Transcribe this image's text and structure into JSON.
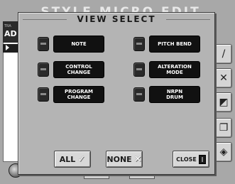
{
  "background": {
    "title": "STYLE MICRO EDIT",
    "header_small": "TRA",
    "header_main": "AD"
  },
  "dialog": {
    "title": "VIEW SELECT",
    "options_left": [
      {
        "label": "NOTE"
      },
      {
        "label": "CONTROL\nCHANGE"
      },
      {
        "label": "PROGRAM\nCHANGE"
      }
    ],
    "options_right": [
      {
        "label": "PITCH BEND"
      },
      {
        "label": "ALTERATION\nMODE"
      },
      {
        "label": "NRPN\nDRUM"
      }
    ],
    "buttons": {
      "all_label": "ALL",
      "all_icon": "check-icon",
      "none_label": "NONE",
      "none_icon": "x-icon",
      "close_label": "CLOSE",
      "close_icon": "door-icon"
    }
  },
  "side_buttons": [
    {
      "icon": "pencil-icon",
      "glyph": "/"
    },
    {
      "icon": "delete-icon",
      "glyph": "✕"
    },
    {
      "icon": "eraser-icon",
      "glyph": "◩"
    },
    {
      "icon": "copy-icon",
      "glyph": "❐"
    },
    {
      "icon": "bottle-icon",
      "glyph": "◈"
    }
  ],
  "colors": {
    "dialog_bg": "#b4b4b4",
    "label_bg": "#111111",
    "led_off": "#2a2a2a"
  }
}
